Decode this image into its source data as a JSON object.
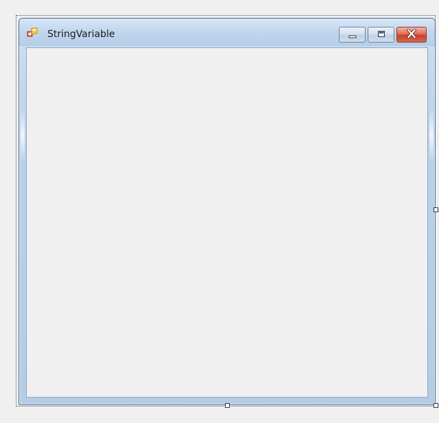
{
  "window": {
    "title": "StringVariable",
    "app_icon": "winforms-app-icon",
    "controls": {
      "minimize_icon": "minimize-icon",
      "maximize_icon": "maximize-icon",
      "close_icon": "close-icon"
    }
  },
  "colors": {
    "client_background": "#f0f0f0",
    "frame": "#b9d1ea",
    "close_button": "#c8442b"
  }
}
